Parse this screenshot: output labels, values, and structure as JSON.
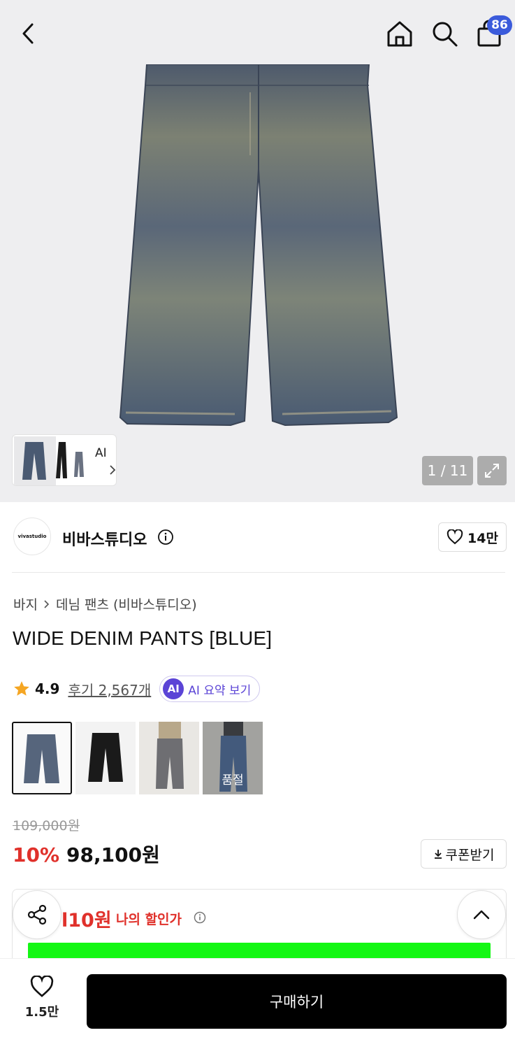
{
  "header": {
    "back_icon": "chevron-left-icon",
    "home_icon": "home-icon",
    "search_icon": "search-icon",
    "cart_icon": "shopping-bag-icon",
    "cart_count": "86"
  },
  "gallery": {
    "thumb_ai_label": "AI",
    "counter": "1 / 11",
    "expand_icon": "expand-icon"
  },
  "brand": {
    "logo_text": "vivastudio",
    "name": "비바스튜디오",
    "info_icon": "info-icon",
    "like_count": "14만"
  },
  "breadcrumb": [
    "바지",
    "데님 팬츠 (비바스튜디오)"
  ],
  "product": {
    "title": "WIDE DENIM PANTS [BLUE]",
    "rating": "4.9",
    "review_link": "후기 2,567개",
    "ai_badge": "AI",
    "ai_summary": "AI 요약 보기",
    "variants": [
      {
        "name": "blue",
        "soldout": ""
      },
      {
        "name": "black",
        "soldout": ""
      },
      {
        "name": "gray-model",
        "soldout": ""
      },
      {
        "name": "light-blue-model",
        "soldout": "품절"
      }
    ],
    "original_price": "109,000원",
    "discount": "10%",
    "price": "98,100원",
    "coupon_label": "쿠폰받기"
  },
  "my_discount": {
    "price_fragment": "l10원",
    "label": "나의 할인가"
  },
  "bottom": {
    "wish_count": "1.5만",
    "buy_label": "구매하기"
  },
  "colors": {
    "accent_red": "#e0312b",
    "badge_blue": "#3b5bdb",
    "ai_purple": "#5b44d6",
    "buy_black": "#000000"
  }
}
